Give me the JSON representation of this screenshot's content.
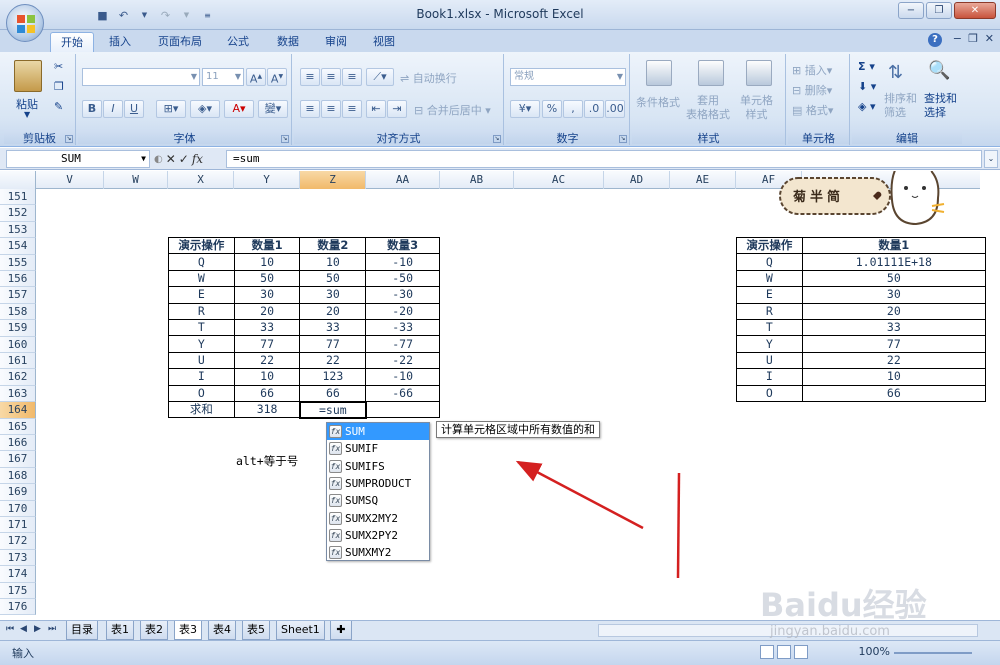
{
  "window": {
    "title": "Book1.xlsx - Microsoft Excel"
  },
  "ribbon_tabs": [
    "开始",
    "插入",
    "页面布局",
    "公式",
    "数据",
    "审阅",
    "视图"
  ],
  "ribbon": {
    "clipboard": {
      "label": "剪贴板",
      "paste": "粘贴"
    },
    "font": {
      "label": "字体",
      "font_name": "",
      "font_size": "11"
    },
    "alignment": {
      "label": "对齐方式",
      "wrap": "自动换行",
      "merge": "合并后居中"
    },
    "number": {
      "label": "数字",
      "format": "常规"
    },
    "styles": {
      "label": "样式",
      "conditional": "条件格式",
      "table": "套用\n表格格式",
      "cell_style": "单元格\n样式"
    },
    "cells": {
      "label": "单元格",
      "insert": "插入",
      "delete": "删除",
      "format": "格式"
    },
    "editing": {
      "label": "编辑",
      "sort": "排序和\n筛选",
      "find": "查找和\n选择"
    }
  },
  "formula_bar": {
    "name_box": "SUM",
    "formula": "=sum"
  },
  "columns": [
    "V",
    "W",
    "X",
    "Y",
    "Z",
    "AA",
    "AB",
    "AC",
    "AD",
    "AE",
    "AF"
  ],
  "rows": [
    "151",
    "152",
    "153",
    "154",
    "155",
    "156",
    "157",
    "158",
    "159",
    "160",
    "161",
    "162",
    "163",
    "164",
    "165",
    "166",
    "167",
    "168",
    "169",
    "170",
    "171",
    "172",
    "173",
    "174",
    "175",
    "176"
  ],
  "table1": {
    "headers": [
      "演示操作",
      "数量1",
      "数量2",
      "数量3"
    ],
    "rows": [
      [
        "Q",
        "10",
        "10",
        "-10"
      ],
      [
        "W",
        "50",
        "50",
        "-50"
      ],
      [
        "E",
        "30",
        "30",
        "-30"
      ],
      [
        "R",
        "20",
        "20",
        "-20"
      ],
      [
        "T",
        "33",
        "33",
        "-33"
      ],
      [
        "Y",
        "77",
        "77",
        "-77"
      ],
      [
        "U",
        "22",
        "22",
        "-22"
      ],
      [
        "I",
        "10",
        "123",
        "-10"
      ],
      [
        "O",
        "66",
        "66",
        "-66"
      ]
    ],
    "sum_label": "求和",
    "sum_value": "318",
    "active_input": "=sum"
  },
  "table2": {
    "headers": [
      "演示操作",
      "数量1"
    ],
    "rows": [
      [
        "Q",
        "1.01111E+18"
      ],
      [
        "W",
        "50"
      ],
      [
        "E",
        "30"
      ],
      [
        "R",
        "20"
      ],
      [
        "T",
        "33"
      ],
      [
        "Y",
        "77"
      ],
      [
        "U",
        "22"
      ],
      [
        "I",
        "10"
      ],
      [
        "O",
        "66"
      ]
    ]
  },
  "note": "alt+等于号",
  "autocomplete": {
    "items": [
      "SUM",
      "SUMIF",
      "SUMIFS",
      "SUMPRODUCT",
      "SUMSQ",
      "SUMX2MY2",
      "SUMX2PY2",
      "SUMXMY2"
    ],
    "tooltip": "计算单元格区域中所有数值的和"
  },
  "sheet_tabs": [
    "目录",
    "表1",
    "表2",
    "表3",
    "表4",
    "表5",
    "Sheet1"
  ],
  "active_sheet": "表3",
  "status": {
    "mode": "输入",
    "zoom": "100%"
  },
  "sticker_text": "菊半简",
  "watermark": {
    "brand": "Baidu经验",
    "url": "jingyan.baidu.com"
  },
  "colors": {
    "accent": "#15428b",
    "selected_header": "#f1b96a",
    "autocomplete_highlight": "#3399ff",
    "arrow": "#d42020"
  }
}
